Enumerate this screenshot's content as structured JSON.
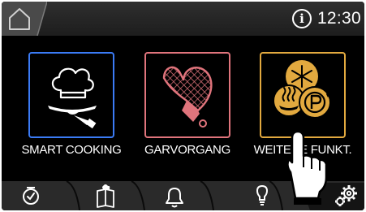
{
  "header": {
    "home_icon": "home-icon",
    "info_icon": "info-icon",
    "info_glyph": "i",
    "time": "12:30"
  },
  "tiles": [
    {
      "label": "SMART COOKING",
      "icon": "chef-hat-serving-cloche-icon",
      "color": "#3b7bf5"
    },
    {
      "label": "GARVORGANG",
      "icon": "oven-mitt-icon",
      "color": "#e0747c"
    },
    {
      "label": "WEITERE FUNKT.",
      "icon": "freeze-steam-p-icon",
      "color": "#e2a93f"
    }
  ],
  "bottom_tabs": [
    {
      "icon": "timer-icon"
    },
    {
      "icon": "recipe-book-icon"
    },
    {
      "icon": "bell-icon"
    },
    {
      "icon": "lightbulb-icon"
    },
    {
      "icon": "settings-gears-icon"
    }
  ],
  "overlay": {
    "icon": "pointing-hand-icon"
  },
  "colors": {
    "background": "#000000",
    "topbar": "#262626",
    "bottombar": "#2a2a2a",
    "text": "#ffffff"
  }
}
